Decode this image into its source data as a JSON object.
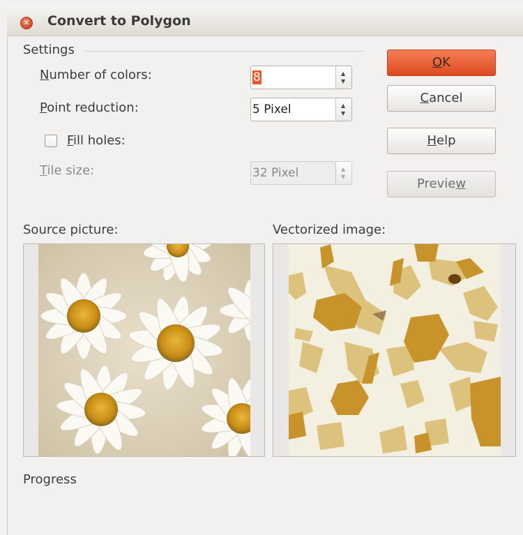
{
  "window": {
    "title": "Convert to Polygon"
  },
  "settings": {
    "section_label": "Settings",
    "number_of_colors": {
      "label_mnemonic": "N",
      "label_rest": "umber of colors:",
      "value": "8"
    },
    "point_reduction": {
      "label_mnemonic": "P",
      "label_rest": "oint reduction:",
      "value": "5 Pixel"
    },
    "fill_holes": {
      "label_mnemonic": "F",
      "label_rest": "ill holes:",
      "checked": false
    },
    "tile_size": {
      "label_mnemonic": "T",
      "label_rest": "ile size:",
      "value": "32 Pixel"
    }
  },
  "buttons": {
    "ok": {
      "mnemonic": "O",
      "rest": "K"
    },
    "cancel": {
      "mnemonic": "C",
      "rest": "ancel"
    },
    "help": {
      "mnemonic": "H",
      "rest": "elp"
    },
    "preview": {
      "before": "Previe",
      "mnemonic": "w"
    }
  },
  "images": {
    "source_label": "Source picture:",
    "vectorized_label": "Vectorized image:"
  },
  "progress": {
    "label": "Progress"
  },
  "colors": {
    "accent": "#de4a1f",
    "vector_dark": "#c8932a",
    "vector_light": "#ddc27e",
    "vector_bg": "#f3efe1"
  }
}
